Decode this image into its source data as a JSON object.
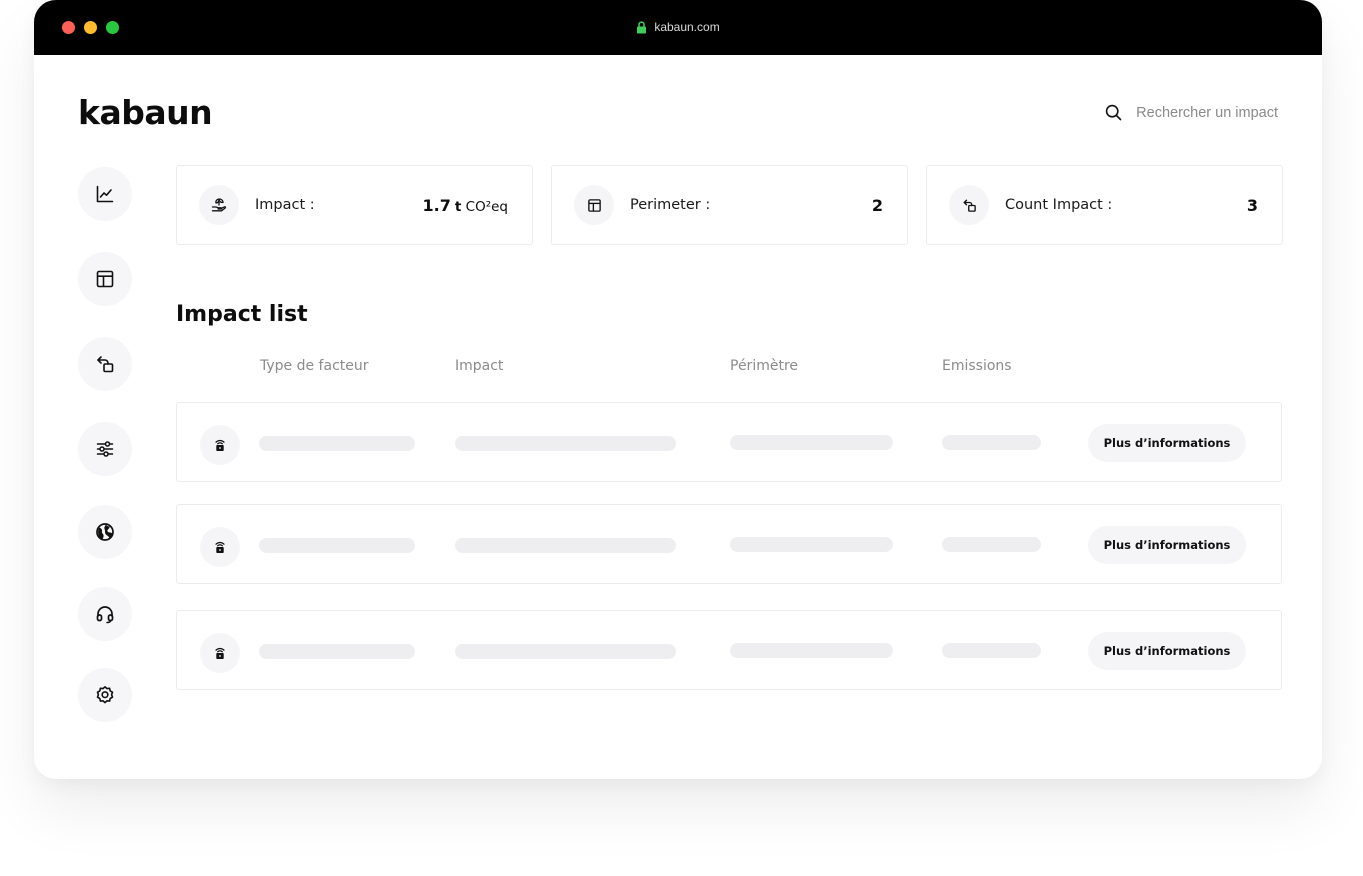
{
  "browser": {
    "url": "kabaun.com",
    "colors": {
      "close": "#ff5f57",
      "minimize": "#febc2e",
      "maximize": "#28c840",
      "lock": "#3ecf5b"
    }
  },
  "app": {
    "logo": "kabaun"
  },
  "search": {
    "placeholder": "Rechercher un impact"
  },
  "sidebar": {
    "items": [
      {
        "name": "dashboard",
        "icon": "chart-line-icon"
      },
      {
        "name": "perimeter",
        "icon": "layout-icon"
      },
      {
        "name": "impacts",
        "icon": "transfer-icon"
      },
      {
        "name": "filters",
        "icon": "sliders-icon"
      },
      {
        "name": "globe",
        "icon": "globe-icon"
      },
      {
        "name": "support",
        "icon": "headset-icon"
      },
      {
        "name": "settings",
        "icon": "gear-icon"
      }
    ]
  },
  "stats": [
    {
      "label": "Impact :",
      "value": "1.7",
      "unit": "t",
      "unit_suffix": "CO²eq",
      "icon": "hand-leaf-icon"
    },
    {
      "label": "Perimeter :",
      "value": "2",
      "icon": "layout-icon"
    },
    {
      "label": "Count Impact :",
      "value": "3",
      "icon": "transfer-icon"
    }
  ],
  "impact_list": {
    "title": "Impact list",
    "columns": [
      "Type de facteur",
      "Impact",
      "Périmètre",
      "Emissions"
    ],
    "rows": [
      {
        "icon": "wifi-lock-icon",
        "action": "Plus d’informations"
      },
      {
        "icon": "wifi-lock-icon",
        "action": "Plus d’informations"
      },
      {
        "icon": "wifi-lock-icon",
        "action": "Plus d’informations"
      }
    ]
  }
}
